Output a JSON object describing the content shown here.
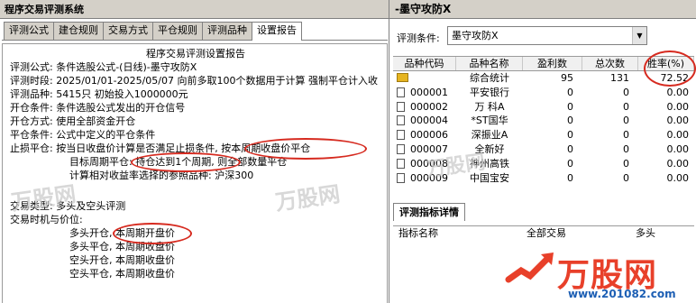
{
  "left_window": {
    "title": "程序交易评测系统",
    "tabs": [
      "评测公式",
      "建仓规则",
      "交易方式",
      "平仓规则",
      "评测品种",
      "设置报告"
    ],
    "active_tab": 5,
    "report": {
      "title": "程序交易评测设置报告",
      "lines": [
        "评测公式: 条件选股公式-(日线)-墨守攻防X",
        "评测时段: 2025/01/01-2025/05/07  向前多取100个数据用于计算  强制平仓计入收",
        "评测品种: 5415只  初始投入1000000元",
        "开仓条件: 条件选股公式发出的开仓信号",
        "开仓方式: 使用全部资金开仓",
        "平仓条件: 公式中定义的平仓条件",
        "止损平仓: 按当日收盘价计算是否满足止损条件, 按本周期收盘价平仓",
        "目标周期平仓: 持仓达到1个周期, 则全部数量平仓",
        "计算相对收益率选择的参照品种: 沪深300",
        "交易类型: 多头及空头评测",
        "交易时机与价位:",
        "多头开仓, 本周期开盘价",
        "多头平仓, 本周期收盘价",
        "空头开仓, 本周期收盘价",
        "空头平仓, 本周期收盘价"
      ]
    }
  },
  "right_window": {
    "title": "-墨守攻防X",
    "condition_label": "评测条件:",
    "condition_value": "墨守攻防X",
    "table_headers": [
      "品种代码",
      "品种名称",
      "盈利数",
      "总次数",
      "胜率(%)"
    ],
    "rows": [
      {
        "code": "",
        "name": "综合统计",
        "wins": "95",
        "total": "131",
        "rate": "72.52"
      },
      {
        "code": "000001",
        "name": "平安银行",
        "wins": "0",
        "total": "0",
        "rate": "0.00"
      },
      {
        "code": "000002",
        "name": "万 科A",
        "wins": "0",
        "total": "0",
        "rate": "0.00"
      },
      {
        "code": "000004",
        "name": "*ST国华",
        "wins": "0",
        "total": "0",
        "rate": "0.00"
      },
      {
        "code": "000006",
        "name": "深振业A",
        "wins": "0",
        "total": "0",
        "rate": "0.00"
      },
      {
        "code": "000007",
        "name": "全新好",
        "wins": "0",
        "total": "0",
        "rate": "0.00"
      },
      {
        "code": "000008",
        "name": "神州高铁",
        "wins": "0",
        "total": "0",
        "rate": "0.00"
      },
      {
        "code": "000009",
        "name": "中国宝安",
        "wins": "0",
        "total": "0",
        "rate": "0.00"
      }
    ],
    "detail_tab": "评测指标详情",
    "detail_headers": [
      "指标名称",
      "全部交易",
      "多头"
    ]
  },
  "watermark": {
    "text": "万股网",
    "url": "www.201082.com",
    "brand_color": "#e8402a",
    "url_color": "#1d5fb4"
  },
  "annotation_color": "#d62a1f"
}
